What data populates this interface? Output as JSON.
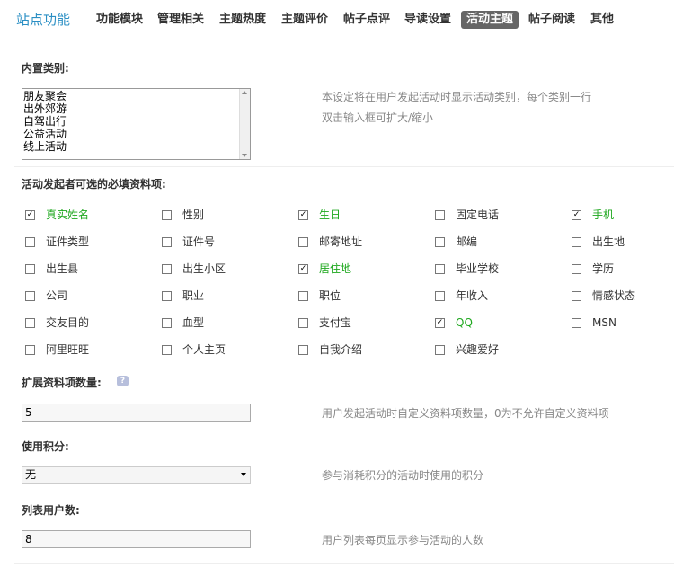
{
  "header": {
    "title": "站点功能",
    "tabs": [
      {
        "label": "功能模块",
        "active": false
      },
      {
        "label": "管理相关",
        "active": false
      },
      {
        "label": "主题热度",
        "active": false
      },
      {
        "label": "主题评价",
        "active": false
      },
      {
        "label": "帖子点评",
        "active": false
      },
      {
        "label": "导读设置",
        "active": false
      },
      {
        "label": "活动主题",
        "active": true
      },
      {
        "label": "帖子阅读",
        "active": false
      },
      {
        "label": "其他",
        "active": false
      }
    ]
  },
  "builtin_categories": {
    "title": "内置类别:",
    "lines": [
      "朋友聚会",
      "出外郊游",
      "自驾出行",
      "公益活动",
      "线上活动"
    ],
    "hint_line1": "本设定将在用户发起活动时显示活动类别，每个类别一行",
    "hint_line2": "双击输入框可扩大/缩小"
  },
  "required_fields": {
    "title": "活动发起者可选的必填资料项:",
    "items": [
      {
        "label": "真实姓名",
        "checked": true
      },
      {
        "label": "性别",
        "checked": false
      },
      {
        "label": "生日",
        "checked": true
      },
      {
        "label": "固定电话",
        "checked": false
      },
      {
        "label": "手机",
        "checked": true
      },
      {
        "label": "证件类型",
        "checked": false
      },
      {
        "label": "证件号",
        "checked": false
      },
      {
        "label": "邮寄地址",
        "checked": false
      },
      {
        "label": "邮编",
        "checked": false
      },
      {
        "label": "出生地",
        "checked": false
      },
      {
        "label": "出生县",
        "checked": false
      },
      {
        "label": "出生小区",
        "checked": false
      },
      {
        "label": "居住地",
        "checked": true
      },
      {
        "label": "毕业学校",
        "checked": false
      },
      {
        "label": "学历",
        "checked": false
      },
      {
        "label": "公司",
        "checked": false
      },
      {
        "label": "职业",
        "checked": false
      },
      {
        "label": "职位",
        "checked": false
      },
      {
        "label": "年收入",
        "checked": false
      },
      {
        "label": "情感状态",
        "checked": false
      },
      {
        "label": "交友目的",
        "checked": false
      },
      {
        "label": "血型",
        "checked": false
      },
      {
        "label": "支付宝",
        "checked": false
      },
      {
        "label": "QQ",
        "checked": true
      },
      {
        "label": "MSN",
        "checked": false
      },
      {
        "label": "阿里旺旺",
        "checked": false
      },
      {
        "label": "个人主页",
        "checked": false
      },
      {
        "label": "自我介绍",
        "checked": false
      },
      {
        "label": "兴趣爱好",
        "checked": false
      }
    ]
  },
  "extended_fields": {
    "title": "扩展资料项数量:",
    "value": "5",
    "hint": "用户发起活动时自定义资料项数量，0为不允许自定义资料项",
    "help_icon": "help-icon"
  },
  "credits": {
    "title": "使用积分:",
    "selected": "无",
    "hint": "参与消耗积分的活动时使用的积分"
  },
  "list_users": {
    "title": "列表用户数:",
    "value": "8",
    "hint": "用户列表每页显示参与活动的人数"
  },
  "colors": {
    "brand": "#2b8fc4",
    "checked_label": "#1fa81f",
    "active_tab_bg": "#666666",
    "hint": "#888888"
  }
}
